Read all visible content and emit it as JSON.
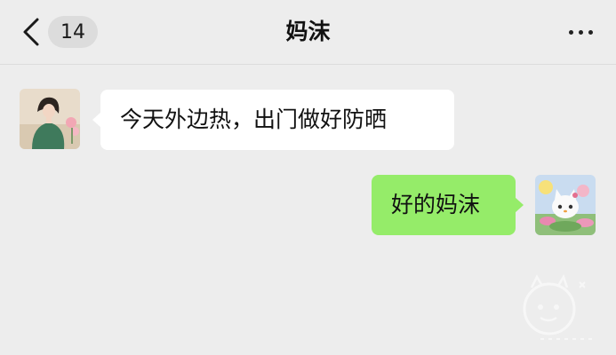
{
  "header": {
    "back_icon": "chevron-left-icon",
    "unread_count": "14",
    "title": "妈沫",
    "more_icon": "ellipsis-icon"
  },
  "messages": [
    {
      "sender": "contact",
      "text": "今天外边热，出门做好防晒"
    },
    {
      "sender": "self",
      "text": "好的妈沫"
    }
  ],
  "colors": {
    "background": "#ededed",
    "incoming_bubble": "#ffffff",
    "outgoing_bubble": "#95ec69"
  }
}
